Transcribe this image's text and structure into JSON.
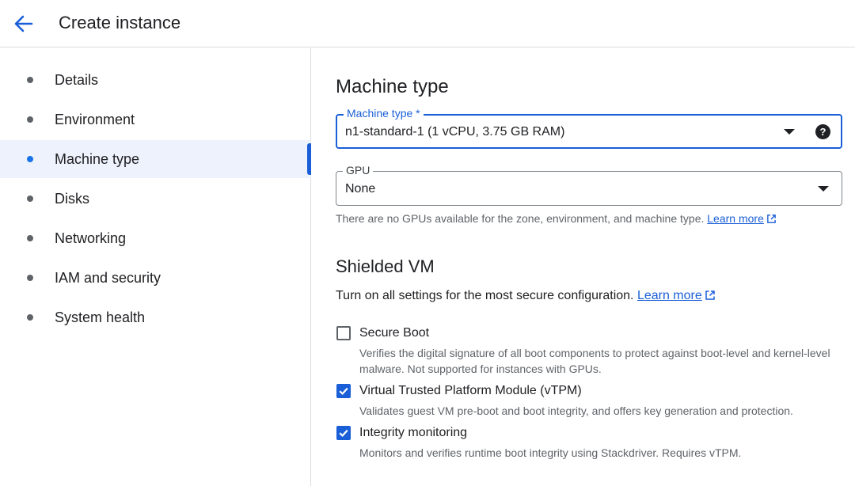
{
  "header": {
    "title": "Create instance",
    "back_icon": "arrow-left-icon"
  },
  "sidebar": {
    "items": [
      {
        "label": "Details"
      },
      {
        "label": "Environment"
      },
      {
        "label": "Machine type",
        "active": true
      },
      {
        "label": "Disks"
      },
      {
        "label": "Networking"
      },
      {
        "label": "IAM and security"
      },
      {
        "label": "System health"
      }
    ]
  },
  "main": {
    "title": "Machine type",
    "machine_type": {
      "label": "Machine type *",
      "value": "n1-standard-1 (1 vCPU, 3.75 GB RAM)"
    },
    "gpu": {
      "label": "GPU",
      "value": "None",
      "hint": "There are no GPUs available for the zone, environment, and machine type.",
      "learn_more": "Learn more"
    },
    "shielded_vm": {
      "title": "Shielded VM",
      "description": "Turn on all settings for the most secure configuration.",
      "learn_more": "Learn more",
      "options": [
        {
          "label": "Secure Boot",
          "checked": false,
          "description": "Verifies the digital signature of all boot components to protect against boot-level and kernel-level malware. Not supported for instances with GPUs."
        },
        {
          "label": "Virtual Trusted Platform Module (vTPM)",
          "checked": true,
          "description": "Validates guest VM pre-boot and boot integrity, and offers key generation and protection."
        },
        {
          "label": "Integrity monitoring",
          "checked": true,
          "description": "Monitors and verifies runtime boot integrity using Stackdriver. Requires vTPM."
        }
      ]
    }
  },
  "colors": {
    "accent": "#1a5fd7",
    "active_bg": "#eef2fc",
    "text": "#202124",
    "secondary_text": "#5f6368"
  }
}
